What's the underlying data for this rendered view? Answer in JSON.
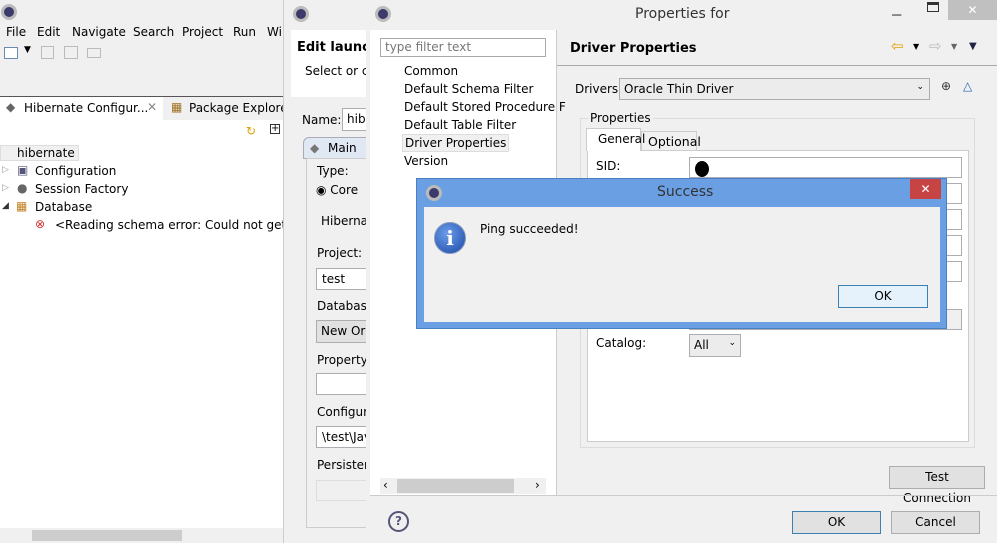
{
  "eclipse": {
    "menu": [
      "File",
      "Edit",
      "Navigate",
      "Search",
      "Project",
      "Run",
      "Wi"
    ],
    "tabs": {
      "hibernate": "Hibernate Configur...",
      "package": "Package Explorer"
    },
    "tree": {
      "root": "hibernate",
      "items": [
        "Configuration",
        "Session Factory",
        "Database"
      ],
      "error": "<Reading schema error: Could not get list c"
    }
  },
  "launch": {
    "title": "Edit launch",
    "subtitle": "Select or co",
    "name_label": "Name:",
    "name_value": "hib",
    "tab": "Main",
    "type_label": "Type:",
    "core": "Core",
    "hibernate": "Hibernat",
    "project_label": "Project:",
    "project_value": "test",
    "database_label": "Database",
    "database_value": "New Ora",
    "property_label": "Property",
    "config_label": "Configura",
    "config_value": "\\test\\Jav",
    "persistence_label": "Persistenc"
  },
  "properties": {
    "title": "Properties for",
    "filter_placeholder": "type filter text",
    "nav": [
      "Common",
      "Default Schema Filter",
      "Default Stored Procedure F",
      "Default Table Filter",
      "Driver Properties",
      "Version"
    ],
    "selected": "Driver Properties",
    "header": "Driver Properties",
    "drivers_label": "Drivers:",
    "driver_value": "Oracle Thin Driver",
    "group_label": "Properties",
    "tabs": [
      "General",
      "Optional"
    ],
    "sid_label": "SID:",
    "catalog_label": "Catalog:",
    "catalog_value": "All",
    "test_connection": "Test Connection",
    "ok": "OK",
    "cancel": "Cancel"
  },
  "success": {
    "title": "Success",
    "message": "Ping succeeded!",
    "ok": "OK",
    "accent": "#6a9fe3"
  }
}
